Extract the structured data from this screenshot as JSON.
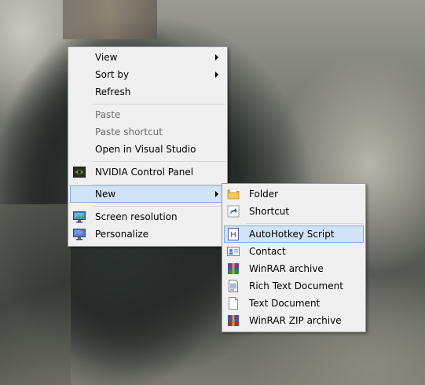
{
  "context_menu": {
    "items": [
      {
        "label": "View",
        "submenu": true,
        "enabled": true
      },
      {
        "label": "Sort by",
        "submenu": true,
        "enabled": true
      },
      {
        "label": "Refresh",
        "enabled": true
      },
      {
        "label": "Paste",
        "enabled": false
      },
      {
        "label": "Paste shortcut",
        "enabled": false
      },
      {
        "label": "Open in Visual Studio",
        "enabled": true
      },
      {
        "label": "NVIDIA Control Panel",
        "enabled": true,
        "icon": "nvidia-icon"
      },
      {
        "label": "New",
        "submenu": true,
        "enabled": true,
        "highlighted": true
      },
      {
        "label": "Screen resolution",
        "enabled": true,
        "icon": "monitor-icon"
      },
      {
        "label": "Personalize",
        "enabled": true,
        "icon": "personalize-icon"
      }
    ]
  },
  "new_submenu": {
    "items": [
      {
        "label": "Folder",
        "icon": "folder-icon"
      },
      {
        "label": "Shortcut",
        "icon": "shortcut-icon"
      },
      {
        "label": "AutoHotkey Script",
        "icon": "autohotkey-icon",
        "highlighted": true
      },
      {
        "label": "Contact",
        "icon": "contact-icon"
      },
      {
        "label": "WinRAR archive",
        "icon": "winrar-icon"
      },
      {
        "label": "Rich Text Document",
        "icon": "rich-text-icon"
      },
      {
        "label": "Text Document",
        "icon": "text-document-icon"
      },
      {
        "label": "WinRAR ZIP archive",
        "icon": "winrar-zip-icon"
      }
    ]
  },
  "colors": {
    "menu_background": "#f0f0f0",
    "menu_border": "#979797",
    "highlight_background": "#d1e3f6",
    "highlight_border": "#84acdd",
    "disabled_text": "#6d6d6d"
  }
}
